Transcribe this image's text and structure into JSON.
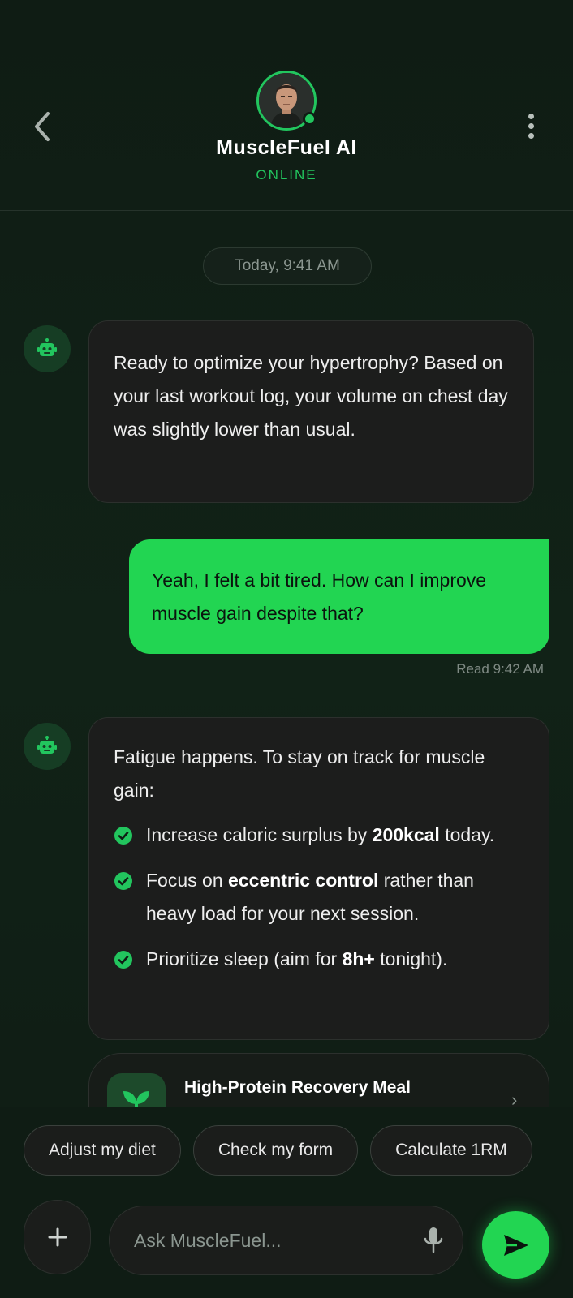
{
  "header": {
    "title": "MuscleFuel AI",
    "status": "ONLINE"
  },
  "chat": {
    "date_label": "Today, 9:41 AM",
    "messages": [
      {
        "from": "bot",
        "text": "Ready to optimize your hypertrophy? Based on your last workout log, your volume on chest day was slightly lower than usual."
      },
      {
        "from": "user",
        "text": "Yeah, I felt a bit tired. How can I improve muscle gain despite that?",
        "receipt": "Read 9:42 AM"
      },
      {
        "from": "bot",
        "intro": "Fatigue happens. To stay on track for muscle gain:",
        "bullets": [
          {
            "pre": "Increase caloric surplus by ",
            "bold": "200kcal",
            "post": " today."
          },
          {
            "pre": "Focus on ",
            "bold": "eccentric control",
            "post": " rather than heavy load for your next session."
          },
          {
            "pre": "Prioritize sleep (aim for ",
            "bold": "8h+",
            "post": " tonight)."
          }
        ]
      }
    ],
    "card": {
      "title": "High-Protein Recovery Meal",
      "icon": "sprout-icon"
    }
  },
  "suggestions": [
    "Adjust my diet",
    "Check my form",
    "Calculate 1RM"
  ],
  "composer": {
    "placeholder": "Ask MuscleFuel...",
    "value": ""
  },
  "colors": {
    "accent": "#22d552",
    "background": "#0f1c14",
    "bubble": "#1c1d1c"
  }
}
